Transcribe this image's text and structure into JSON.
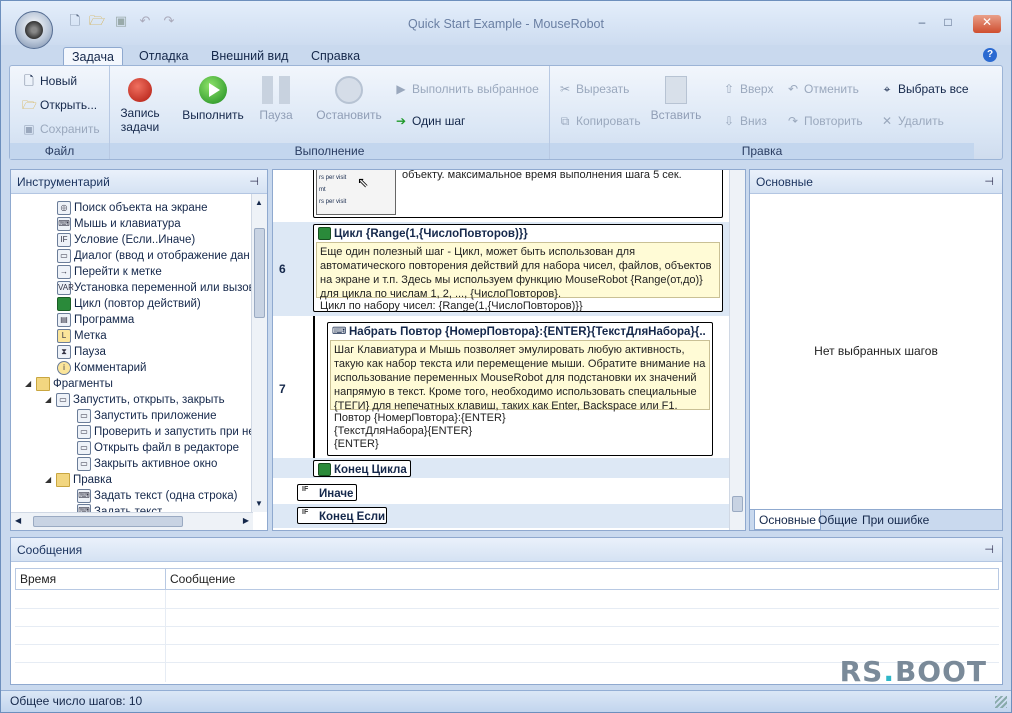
{
  "window": {
    "title": "Quick Start Example - MouseRobot"
  },
  "tabs": [
    "Задача",
    "Отладка",
    "Внешний вид",
    "Справка"
  ],
  "ribbon": {
    "file": {
      "label": "Файл",
      "new": "Новый",
      "open": "Открыть...",
      "save": "Сохранить"
    },
    "run": {
      "label": "Выполнение",
      "record_line1": "Запись",
      "record_line2": "задачи",
      "execute": "Выполнить",
      "pause": "Пауза",
      "stop": "Остановить",
      "run_selected": "Выполнить выбранное",
      "one_step": "Один шаг"
    },
    "edit": {
      "label": "Правка",
      "cut": "Вырезать",
      "copy": "Копировать",
      "paste": "Вставить",
      "up": "Вверх",
      "down": "Вниз",
      "undo": "Отменить",
      "redo": "Повторить",
      "select_all": "Выбрать все",
      "delete": "Удалить"
    }
  },
  "toolbox": {
    "title": "Инструментарий",
    "items": [
      "Поиск объекта на экране",
      "Мышь и клавиатура",
      "Условие (Если..Иначе)",
      "Диалог (ввод и отображение дан",
      "Перейти к метке",
      "Установка переменной или вызов",
      "Цикл (повтор действий)",
      "Программа",
      "Метка",
      "Пауза",
      "Комментарий",
      "Фрагменты",
      "Запустить, открыть, закрыть",
      "Запустить приложение",
      "Проверить и запустить при не",
      "Открыть файл в редакторе",
      "Закрыть активное окно",
      "Правка",
      "Задать текст (одна строка)",
      "Задать текст"
    ]
  },
  "editor": {
    "top_desc": "объекту. максимальное время выполнения шага 5 сек.",
    "thumb_lines": [
      "rs per visit",
      "mt",
      "rs per visit"
    ],
    "row6_num": "6",
    "cycle_title": "Цикл {Range(1,{ЧислоПовторов)}}",
    "cycle_desc": "Еще один полезный шаг - Цикл, может быть использован для автоматического повторения действий для набора чисел, файлов, объектов на экране и т.п. Здесь мы используем функцию MouseRobot {Range(от,до)} для цикла по числам 1, 2, ..., {ЧислоПовторов}.",
    "cycle_body": "Цикл по набору чисел: {Range(1,{ЧислоПовторов)}}",
    "row7_num": "7",
    "type_title": "Набрать Повтор {НомерПовтора}:{ENTER}{ТекстДляНабора}{..",
    "type_desc": "Шаг Клавиатура и Мышь позволяет эмулировать любую активность, такую как набор текста или перемещение мыши. Обратите внимание на использование переменных MouseRobot для подстановки их значений напрямую в текст. Кроме того, необходимо использовать специальные {ТЕГИ} для непечатных клавиш, таких как Enter, Backspace или F1.",
    "type_body": "Повтор {НомерПовтора}:{ENTER}\n{ТекстДляНабора}{ENTER}\n{ENTER}",
    "end_cycle": "Конец Цикла",
    "else": "Иначе",
    "end_if": "Конец Если"
  },
  "props": {
    "title": "Основные",
    "empty": "Нет выбранных шагов",
    "tabs": [
      "Основные",
      "Общие",
      "При ошибке"
    ]
  },
  "messages": {
    "title": "Сообщения",
    "col_time": "Время",
    "col_message": "Сообщение"
  },
  "status": {
    "text": "Общее число шагов: 10"
  },
  "watermark": {
    "part1": "RS",
    "part2": ".",
    "part3": "BOOT"
  },
  "colors": {
    "accent": "#2b6ad1",
    "cycle_green": "#2a8a3a",
    "note_yellow": "#fffbd6",
    "watermark": "#7a8a99",
    "watermark_accent": "#2fb7c8"
  }
}
